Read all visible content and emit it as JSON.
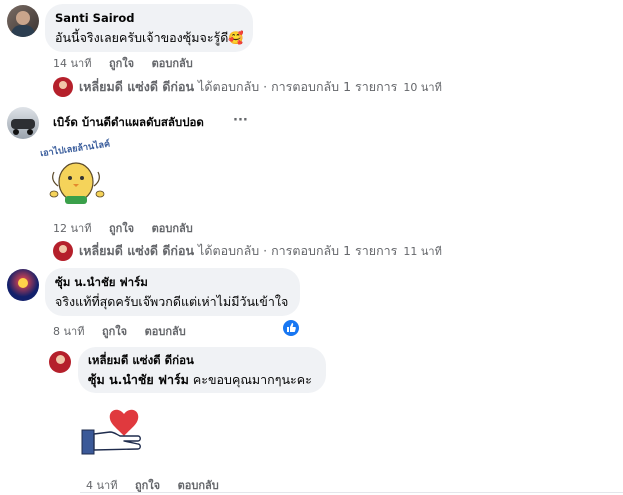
{
  "comments": [
    {
      "author": "Santi Sairod",
      "text": "อันนี้จริงเลยครับเจ้าของซุ้มจะรู้ดี🥰",
      "time": "14 นาที",
      "like": "ถูกใจ",
      "reply": "ตอบกลับ",
      "reply_summary": {
        "name": "เหลี่ยมดี แซ่งดี ดีก่อน",
        "text": "ได้ตอบกลับ · การตอบกลับ 1 รายการ",
        "time": "10 นาที"
      }
    },
    {
      "author": "เบิร์ด บ้านดีดำแผลดับสลับปอด",
      "more": "···",
      "sticker_text": "เอาไปเลยล้านไลค์",
      "time": "12 นาที",
      "like": "ถูกใจ",
      "reply": "ตอบกลับ",
      "reply_summary": {
        "name": "เหลี่ยมดี แซ่งดี ดีก่อน",
        "text": "ได้ตอบกลับ · การตอบกลับ 1 รายการ",
        "time": "11 นาที"
      }
    },
    {
      "author": "ซุ้ม น.นำชัย ฟาร์ม",
      "text": "จริงแท้ที่สุดครับเจ๊พวกดีแต่เห่าไม่มีวันเข้าใจ",
      "time": "8 นาที",
      "like": "ถูกใจ",
      "reply": "ตอบกลับ",
      "reaction": "like"
    }
  ],
  "reply": {
    "author": "เหลี่ยมดี แซ่งดี ดีก่อน",
    "mention": "ซุ้ม น.นำชัย ฟาร์ม",
    "text": " คะขอบคุณมากๆนะคะ",
    "time": "4 นาที",
    "like": "ถูกใจ",
    "reply": "ตอบกลับ"
  },
  "colors": {
    "bubble": "#f0f2f5",
    "meta": "#65676b",
    "like_blue": "#1877f2",
    "heart": "#e0393e",
    "hand": "#3b5998"
  }
}
